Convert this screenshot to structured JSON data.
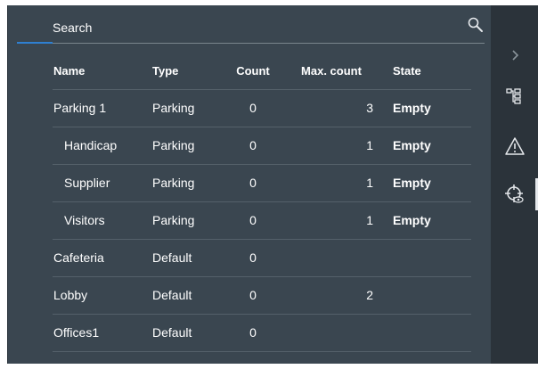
{
  "search": {
    "placeholder": "Search",
    "icon": "search-icon"
  },
  "table": {
    "headers": {
      "name": "Name",
      "type": "Type",
      "count": "Count",
      "max_count": "Max. count",
      "state": "State"
    },
    "rows": [
      {
        "name": "Parking 1",
        "type": "Parking",
        "count": "0",
        "max_count": "3",
        "state": "Empty",
        "child": false
      },
      {
        "name": "Handicap",
        "type": "Parking",
        "count": "0",
        "max_count": "1",
        "state": "Empty",
        "child": true
      },
      {
        "name": "Supplier",
        "type": "Parking",
        "count": "0",
        "max_count": "1",
        "state": "Empty",
        "child": true
      },
      {
        "name": "Visitors",
        "type": "Parking",
        "count": "0",
        "max_count": "1",
        "state": "Empty",
        "child": true
      },
      {
        "name": "Cafeteria",
        "type": "Default",
        "count": "0",
        "max_count": "",
        "state": "",
        "child": false
      },
      {
        "name": "Lobby",
        "type": "Default",
        "count": "0",
        "max_count": "2",
        "state": "",
        "child": false
      },
      {
        "name": "Offices1",
        "type": "Default",
        "count": "0",
        "max_count": "",
        "state": "",
        "child": false
      }
    ]
  },
  "rail": {
    "items": [
      "expand-chevron-icon",
      "tree-view-icon",
      "warning-icon",
      "monitoring-target-icon"
    ]
  },
  "colors": {
    "panel": "#3a4650",
    "rail": "#2b333a",
    "accent": "#2f80d1",
    "text": "#ffffff"
  }
}
